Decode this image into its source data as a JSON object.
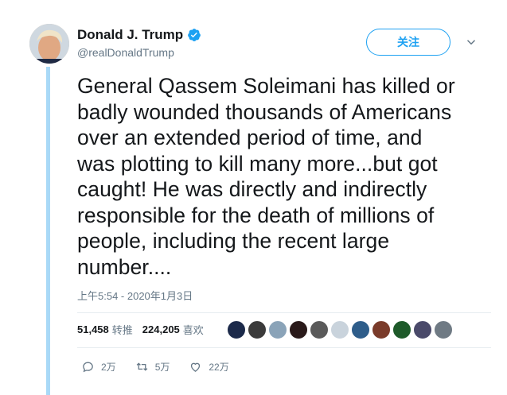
{
  "author": {
    "name": "Donald J. Trump",
    "handle": "@realDonaldTrump",
    "verified_color": "#1da1f2"
  },
  "follow_label": "关注",
  "tweet": {
    "lines": [
      "General Qassem Soleimani has killed or",
      "badly wounded thousands of Americans",
      "over an extended period of time, and",
      "was plotting to kill many more...but got",
      "caught! He was directly and indirectly",
      "responsible for the death of millions of",
      "people, including the recent large",
      "number...."
    ],
    "timestamp": "上午5:54 - 2020年1月3日"
  },
  "stats": {
    "retweets": "51,458",
    "retweets_label": "转推",
    "likes": "224,205",
    "likes_label": "喜欢"
  },
  "liker_avatars": [
    "#1c2a4a",
    "#3b3b3b",
    "#8aa3b8",
    "#2a1a1a",
    "#5a5a5a",
    "#c9d3dc",
    "#2e5d8a",
    "#7a3b2a",
    "#1e5a2a",
    "#4a4a6a",
    "#6f7a84"
  ],
  "actions": {
    "replies": "2万",
    "retweets": "5万",
    "likes": "22万"
  },
  "colors": {
    "accent": "#1da1f2",
    "thread_line": "#a9d9f7",
    "secondary_text": "#657786"
  }
}
